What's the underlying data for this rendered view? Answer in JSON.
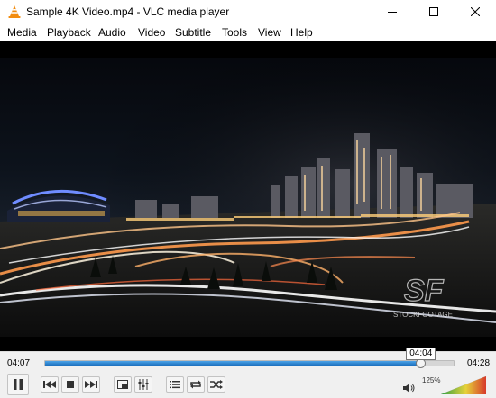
{
  "window": {
    "title": "Sample 4K Video.mp4 - VLC media player"
  },
  "menu": [
    {
      "label": "Media"
    },
    {
      "label": "Playback"
    },
    {
      "label": "Audio"
    },
    {
      "label": "Video"
    },
    {
      "label": "Subtitle"
    },
    {
      "label": "Tools"
    },
    {
      "label": "View"
    },
    {
      "label": "Help"
    }
  ],
  "player": {
    "elapsed": "04:07",
    "total": "04:28",
    "hover_time": "04:04",
    "progress_fraction": 0.92,
    "volume_label": "125%",
    "volume_fraction": 1.0
  },
  "video": {
    "watermark": "STOCKFOOTAGE"
  },
  "colors": {
    "seek_fill": "#1c6fbd",
    "volume_low": "#2ea043",
    "volume_high": "#d73a2a"
  },
  "icons": {
    "app": "vlc-cone-icon",
    "minimize": "minimize-icon",
    "maximize": "maximize-icon",
    "close": "close-icon",
    "pause": "pause-icon",
    "previous": "previous-icon",
    "stop": "stop-icon",
    "next": "next-icon",
    "fullscreen": "fullscreen-icon",
    "extended": "extended-settings-icon",
    "playlist": "playlist-icon",
    "loop": "loop-icon",
    "shuffle": "shuffle-icon",
    "volume": "speaker-icon"
  }
}
